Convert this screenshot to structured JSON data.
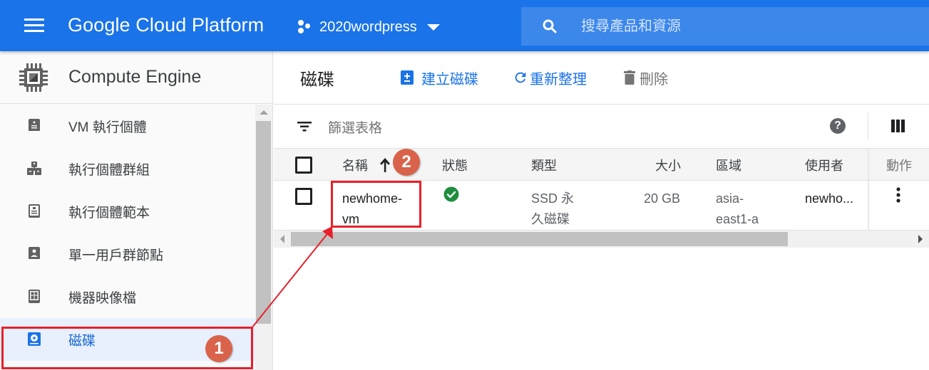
{
  "header": {
    "brand": "Google Cloud Platform",
    "project": "2020wordpress",
    "search_placeholder": "搜尋產品和資源"
  },
  "sidebar": {
    "title": "Compute Engine",
    "items": [
      {
        "label": "VM 執行個體",
        "icon": "vm-instance-icon",
        "active": false
      },
      {
        "label": "執行個體群組",
        "icon": "instance-group-icon",
        "active": false
      },
      {
        "label": "執行個體範本",
        "icon": "instance-template-icon",
        "active": false
      },
      {
        "label": "單一用戶群節點",
        "icon": "sole-tenant-icon",
        "active": false
      },
      {
        "label": "機器映像檔",
        "icon": "machine-image-icon",
        "active": false
      },
      {
        "label": "磁碟",
        "icon": "disk-icon",
        "active": true
      }
    ]
  },
  "main": {
    "title": "磁碟",
    "toolbar": {
      "create": "建立磁碟",
      "refresh": "重新整理",
      "delete": "刪除"
    },
    "filter_placeholder": "篩選表格",
    "table": {
      "columns": {
        "name": "名稱",
        "status": "狀態",
        "type": "類型",
        "size": "大小",
        "zone": "區域",
        "user": "使用者",
        "actions": "動作"
      },
      "sort": {
        "column": "name",
        "direction": "ascending"
      },
      "rows": [
        {
          "name_line1": "newhome-",
          "name_line2": "vm",
          "status": "ready",
          "type_line1": "SSD 永",
          "type_line2": "久磁碟",
          "size": "20 GB",
          "zone_line1": "asia-",
          "zone_line2": "east1-a",
          "user": "newho..."
        }
      ]
    }
  },
  "annotations": {
    "badge1": "1",
    "badge2": "2",
    "color": "#e8202a",
    "badge_color": "#d9634a"
  },
  "colors": {
    "topbar": "#1a73e8",
    "accent": "#1a73e8",
    "active_bg": "#e8f0fe",
    "status_ok": "#1e8e3e"
  }
}
